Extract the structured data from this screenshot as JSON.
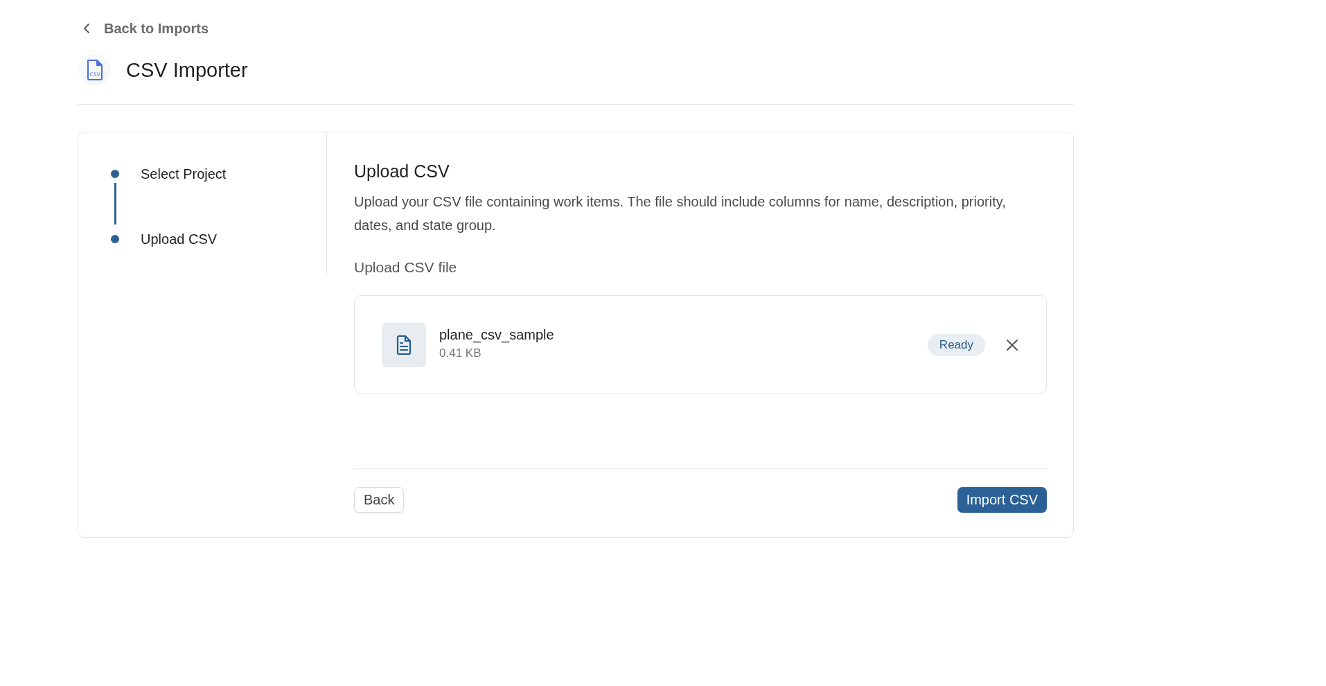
{
  "back_link": {
    "label": "Back to Imports"
  },
  "header": {
    "title": "CSV Importer",
    "icon_label": "CSV"
  },
  "steps": [
    {
      "label": "Select Project"
    },
    {
      "label": "Upload CSV"
    }
  ],
  "panel": {
    "title": "Upload CSV",
    "description": "Upload your CSV file containing work items. The file should include columns for name, description, priority, dates, and state group.",
    "field_label": "Upload CSV file",
    "file": {
      "name": "plane_csv_sample",
      "size": "0.41 KB",
      "status": "Ready"
    }
  },
  "buttons": {
    "back": "Back",
    "submit": "Import CSV"
  }
}
